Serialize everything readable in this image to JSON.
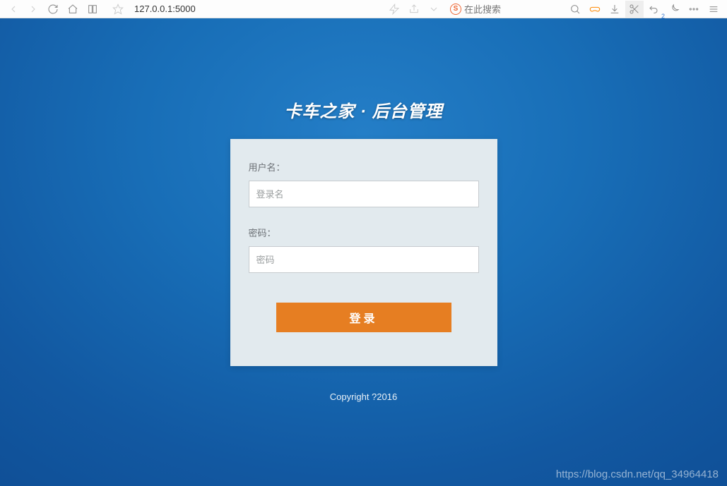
{
  "browser": {
    "address": "127.0.0.1:5000",
    "search_placeholder": "在此搜索"
  },
  "page": {
    "title": "卡车之家 · 后台管理"
  },
  "form": {
    "username_label": "用户名：",
    "username_placeholder": "登录名",
    "password_label": "密码：",
    "password_placeholder": "密码",
    "login_button": "登录"
  },
  "footer": {
    "copyright": "Copyright ?2016"
  },
  "watermark": "https://blog.csdn.net/qq_34964418"
}
